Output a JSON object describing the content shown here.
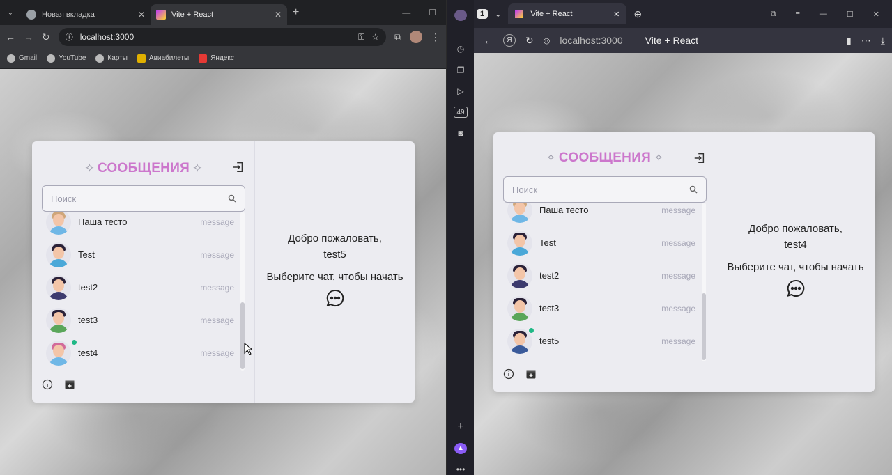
{
  "chrome": {
    "tabs": [
      {
        "label": "Новая вкладка"
      },
      {
        "label": "Vite + React"
      }
    ],
    "url": "localhost:3000",
    "bookmarks": [
      "Gmail",
      "YouTube",
      "Карты",
      "Авиабилеты",
      "Яндекс"
    ]
  },
  "yandex": {
    "tab_count": "1",
    "tab_title": "Vite + React",
    "url": "localhost:3000",
    "page_title": "Vite + React",
    "sidebar_badge": "49"
  },
  "app_left": {
    "header": "СООБЩЕНИЯ",
    "search_placeholder": "Поиск",
    "users": [
      {
        "name": "Паша тесто",
        "msg": "message"
      },
      {
        "name": "Test",
        "msg": "message"
      },
      {
        "name": "test2",
        "msg": "message"
      },
      {
        "name": "test3",
        "msg": "message"
      },
      {
        "name": "test4",
        "msg": "message"
      }
    ],
    "welcome": "Добро пожаловать,",
    "username": "test5",
    "choose": "Выберите чат, чтобы начать"
  },
  "app_right": {
    "header": "СООБЩЕНИЯ",
    "search_placeholder": "Поиск",
    "users": [
      {
        "name": "Паша тесто",
        "msg": "message"
      },
      {
        "name": "Test",
        "msg": "message"
      },
      {
        "name": "test2",
        "msg": "message"
      },
      {
        "name": "test3",
        "msg": "message"
      },
      {
        "name": "test5",
        "msg": "message"
      }
    ],
    "welcome": "Добро пожаловать,",
    "username": "test4",
    "choose": "Выберите чат, чтобы начать"
  },
  "colors": {
    "accent": "#cc77cc",
    "online": "#1fb886"
  }
}
